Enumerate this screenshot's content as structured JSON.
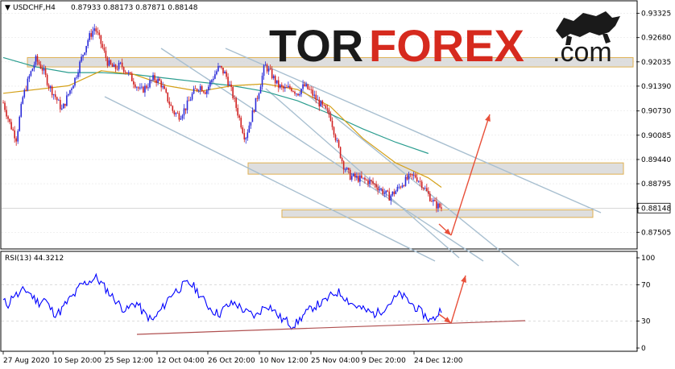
{
  "header": {
    "symbol": "USDCHF,H4",
    "ohlc": "0.87933 0.88173 0.87871 0.88148"
  },
  "logo": {
    "part1": "TOR",
    "part2": "FOREX",
    "part3": ".com"
  },
  "rsi_label": "RSI(13) 44.3212",
  "colors": {
    "bull": "#2b2bd8",
    "bear": "#d02020",
    "ma_fast": "#d4a017",
    "ma_slow": "#2a9d8f",
    "channel": "#a8bfd0",
    "zone_fill": "#d3d3d3",
    "zone_border": "#e0b050",
    "arrow": "#e8503a",
    "rsi_line": "#0000ff",
    "rsi_support": "#b05050"
  },
  "chart_data": [
    {
      "type": "candlestick",
      "title": "USDCHF,H4",
      "y_ticks": [
        "0.93325",
        "0.92680",
        "0.92035",
        "0.91390",
        "0.90730",
        "0.90085",
        "0.89440",
        "0.88795",
        "0.88148",
        "0.87505"
      ],
      "current_price": "0.88148",
      "ylim": [
        0.8734,
        0.9338
      ],
      "x_ticks": [
        "27 Aug 2020",
        "10 Sep 20:00",
        "25 Sep 12:00",
        "12 Oct 04:00",
        "26 Oct 20:00",
        "10 Nov 12:00",
        "25 Nov 04:00",
        "9 Dec 20:00",
        "24 Dec 12:00"
      ],
      "price_path": [
        [
          0,
          0.9095
        ],
        [
          2,
          0.904
        ],
        [
          4,
          0.9
        ],
        [
          6,
          0.911
        ],
        [
          8,
          0.9165
        ],
        [
          10,
          0.921
        ],
        [
          12,
          0.9185
        ],
        [
          14,
          0.914
        ],
        [
          16,
          0.911
        ],
        [
          18,
          0.9075
        ],
        [
          20,
          0.912
        ],
        [
          22,
          0.916
        ],
        [
          24,
          0.9215
        ],
        [
          26,
          0.9265
        ],
        [
          28,
          0.9295
        ],
        [
          30,
          0.925
        ],
        [
          32,
          0.92
        ],
        [
          34,
          0.9185
        ],
        [
          36,
          0.9195
        ],
        [
          38,
          0.9175
        ],
        [
          40,
          0.915
        ],
        [
          42,
          0.9125
        ],
        [
          44,
          0.914
        ],
        [
          46,
          0.916
        ],
        [
          48,
          0.915
        ],
        [
          50,
          0.911
        ],
        [
          52,
          0.907
        ],
        [
          54,
          0.906
        ],
        [
          56,
          0.9085
        ],
        [
          58,
          0.912
        ],
        [
          60,
          0.914
        ],
        [
          62,
          0.9125
        ],
        [
          64,
          0.916
        ],
        [
          66,
          0.919
        ],
        [
          68,
          0.917
        ],
        [
          70,
          0.912
        ],
        [
          72,
          0.906
        ],
        [
          74,
          0.9
        ],
        [
          76,
          0.906
        ],
        [
          78,
          0.912
        ],
        [
          80,
          0.9195
        ],
        [
          82,
          0.917
        ],
        [
          84,
          0.914
        ],
        [
          86,
          0.913
        ],
        [
          88,
          0.9135
        ],
        [
          90,
          0.912
        ],
        [
          92,
          0.914
        ],
        [
          94,
          0.9125
        ],
        [
          96,
          0.91
        ],
        [
          98,
          0.908
        ],
        [
          100,
          0.906
        ],
        [
          102,
          0.899
        ],
        [
          104,
          0.893
        ],
        [
          106,
          0.89
        ],
        [
          108,
          0.8895
        ],
        [
          110,
          0.889
        ],
        [
          112,
          0.8885
        ],
        [
          114,
          0.8875
        ],
        [
          116,
          0.886
        ],
        [
          118,
          0.8845
        ],
        [
          120,
          0.886
        ],
        [
          122,
          0.888
        ],
        [
          124,
          0.8895
        ],
        [
          126,
          0.89
        ],
        [
          128,
          0.888
        ],
        [
          130,
          0.885
        ],
        [
          132,
          0.8825
        ],
        [
          134,
          0.8815
        ]
      ],
      "price_x_range": [
        0,
        134
      ],
      "ma_fast": [
        [
          0,
          0.912
        ],
        [
          20,
          0.914
        ],
        [
          30,
          0.918
        ],
        [
          40,
          0.917
        ],
        [
          50,
          0.914
        ],
        [
          60,
          0.9125
        ],
        [
          70,
          0.914
        ],
        [
          80,
          0.9145
        ],
        [
          90,
          0.913
        ],
        [
          100,
          0.9085
        ],
        [
          110,
          0.9
        ],
        [
          120,
          0.8935
        ],
        [
          130,
          0.8895
        ],
        [
          134,
          0.887
        ]
      ],
      "ma_slow": [
        [
          0,
          0.9215
        ],
        [
          10,
          0.919
        ],
        [
          20,
          0.9175
        ],
        [
          30,
          0.9175
        ],
        [
          40,
          0.917
        ],
        [
          50,
          0.916
        ],
        [
          60,
          0.915
        ],
        [
          70,
          0.914
        ],
        [
          80,
          0.9125
        ],
        [
          90,
          0.91
        ],
        [
          100,
          0.9065
        ],
        [
          110,
          0.9025
        ],
        [
          120,
          0.899
        ],
        [
          130,
          0.896
        ]
      ],
      "resistance_zones": [
        [
          0.9215,
          0.919
        ],
        [
          0.8935,
          0.8905
        ],
        [
          0.881,
          0.879
        ]
      ]
    },
    {
      "type": "line",
      "title": "RSI(13) 44.3212",
      "y_ticks": [
        "100",
        "70",
        "30",
        "0"
      ],
      "ylim": [
        0,
        100
      ],
      "values": [
        52,
        48,
        60,
        58,
        65,
        62,
        55,
        50,
        55,
        45,
        38,
        40,
        48,
        55,
        60,
        70,
        72,
        75,
        78,
        72,
        65,
        58,
        52,
        45,
        42,
        48,
        50,
        40,
        35,
        30,
        38,
        45,
        55,
        62,
        65,
        70,
        72,
        68,
        60,
        52,
        45,
        40,
        38,
        45,
        48,
        50,
        45,
        40,
        38,
        35,
        42,
        48,
        45,
        38,
        32,
        30,
        25,
        28,
        35,
        40,
        45,
        48,
        50,
        55,
        60,
        62,
        58,
        52,
        48,
        45,
        42,
        40,
        38,
        40,
        45,
        50,
        55,
        60,
        55,
        50,
        45,
        40,
        35,
        30,
        35,
        44
      ]
    }
  ]
}
